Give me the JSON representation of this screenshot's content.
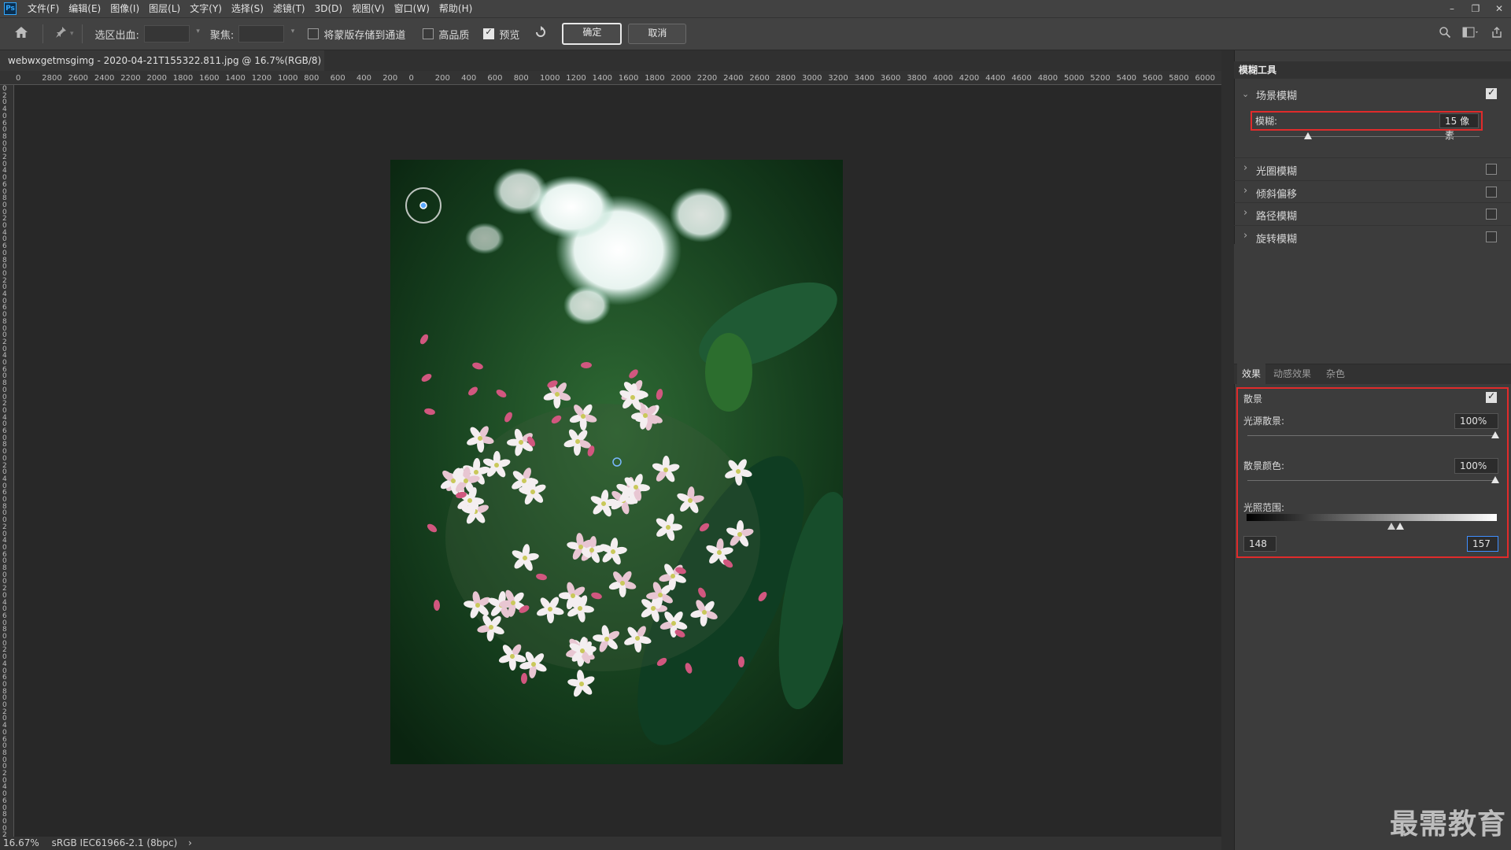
{
  "menu": {
    "app_icon": "Ps",
    "items": [
      "文件(F)",
      "编辑(E)",
      "图像(I)",
      "图层(L)",
      "文字(Y)",
      "选择(S)",
      "滤镜(T)",
      "3D(D)",
      "视图(V)",
      "窗口(W)",
      "帮助(H)"
    ],
    "window_controls": [
      "–",
      "❐",
      "✕"
    ]
  },
  "options": {
    "output_label": "选区出血:",
    "focus_label": "聚焦:",
    "save_mask_label": "将蒙版存储到通道",
    "high_quality_label": "高品质",
    "preview_label": "预览",
    "ok_label": "确定",
    "cancel_label": "取消"
  },
  "document": {
    "tab_title": "webwxgetmsgimg - 2020-04-21T155322.811.jpg @ 16.7%(RGB/8)",
    "close_glyph": "×"
  },
  "ruler": {
    "labels": [
      "0",
      "2800",
      "2600",
      "2400",
      "2200",
      "2000",
      "1800",
      "1600",
      "1400",
      "1200",
      "1000",
      "800",
      "600",
      "400",
      "200",
      "0",
      "200",
      "400",
      "600",
      "800",
      "1000",
      "1200",
      "1400",
      "1600",
      "1800",
      "2000",
      "2200",
      "2400",
      "2600",
      "2800",
      "3000",
      "3200",
      "3400",
      "3600",
      "3800",
      "4000",
      "4200",
      "4400",
      "4600",
      "4800",
      "5000",
      "5200",
      "5400",
      "5600",
      "5800",
      "6000",
      "620"
    ]
  },
  "blur_tools": {
    "panel_title": "模糊工具",
    "field_blur": {
      "label": "场景模糊",
      "checked": true,
      "blur_label": "模糊:",
      "blur_value": "15 像素",
      "blur_slider_fraction": 0.22
    },
    "collapsed": [
      {
        "label": "光圈模糊",
        "checked": false
      },
      {
        "label": "倾斜偏移",
        "checked": false
      },
      {
        "label": "路径模糊",
        "checked": false
      },
      {
        "label": "旋转模糊",
        "checked": false
      }
    ]
  },
  "effects": {
    "tabs": [
      "效果",
      "动感效果",
      "杂色"
    ],
    "bokeh_label": "散景",
    "bokeh_checked": true,
    "light_bokeh_label": "光源散景:",
    "light_bokeh_value": "100%",
    "bokeh_color_label": "散景颜色:",
    "bokeh_color_value": "100%",
    "light_range_label": "光照范围:",
    "light_range_low": "148",
    "light_range_high": "157"
  },
  "status": {
    "zoom": "16.67%",
    "profile": "sRGB IEC61966-2.1 (8bpc)",
    "arrow": "›"
  },
  "watermark": "最需教育",
  "colors": {
    "highlight": "#e02b2b",
    "panel": "#3c3c3c",
    "canvas": "#282828"
  }
}
